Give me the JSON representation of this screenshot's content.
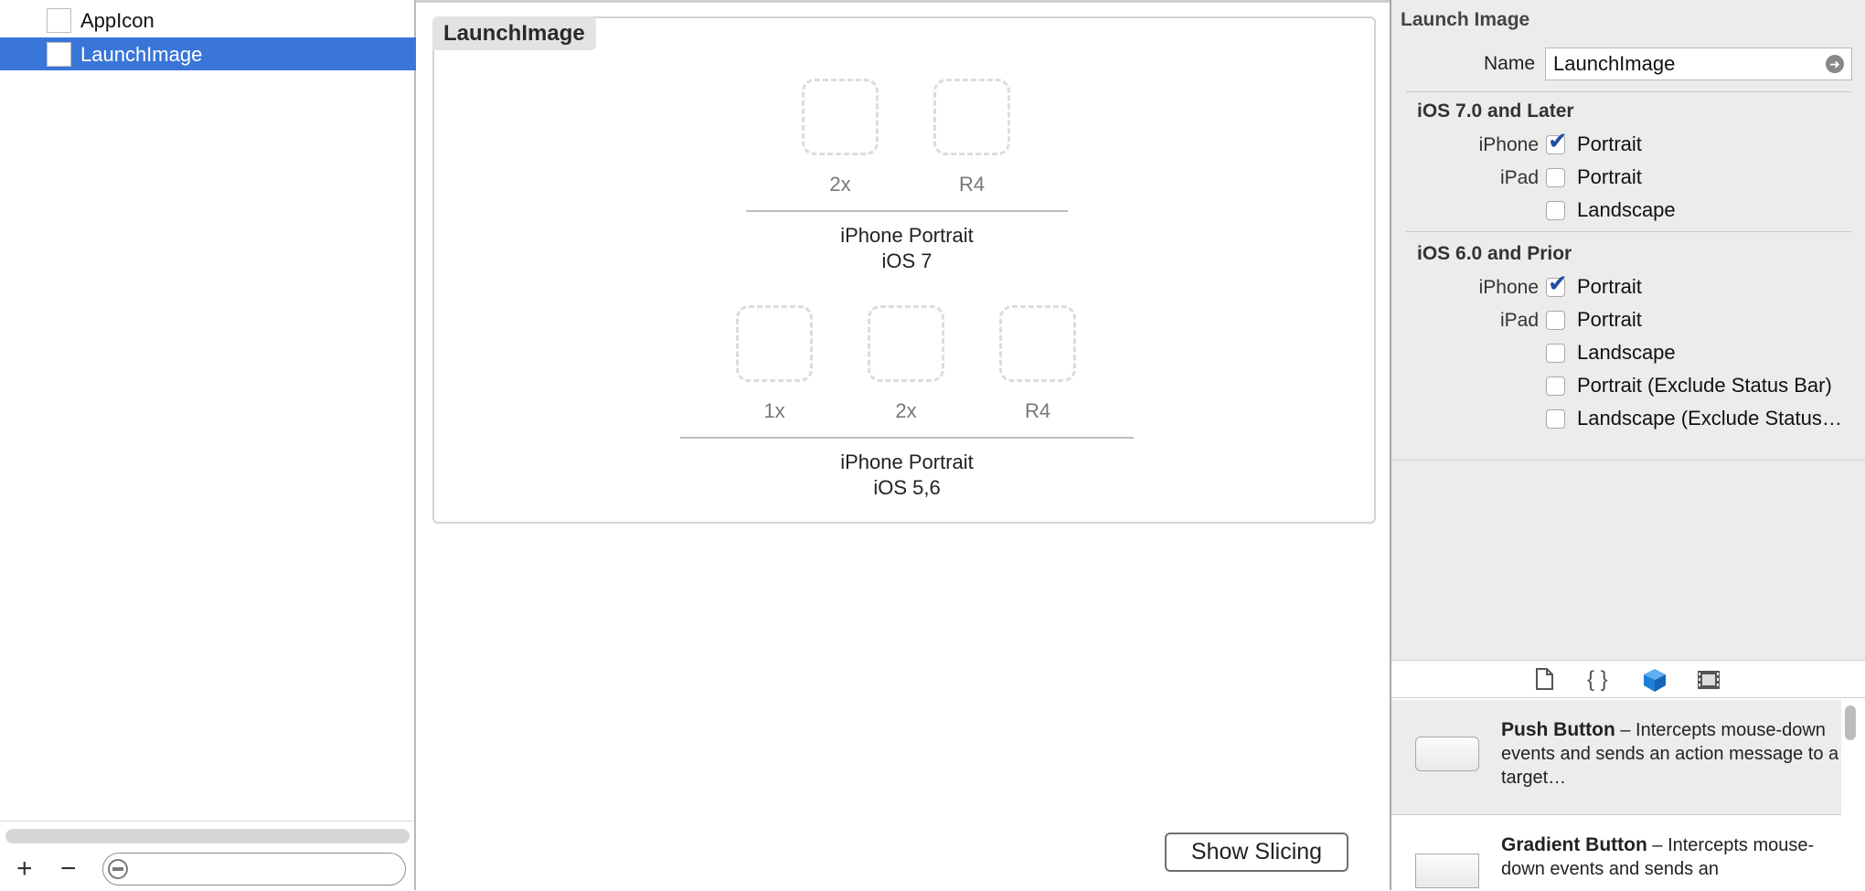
{
  "navigator": {
    "assets": [
      {
        "label": "AppIcon",
        "selected": false
      },
      {
        "label": "LaunchImage",
        "selected": true
      }
    ],
    "add_symbol": "+",
    "remove_symbol": "−"
  },
  "editor": {
    "set_title": "LaunchImage",
    "groups": [
      {
        "slots": [
          "2x",
          "R4"
        ],
        "caption_line1": "iPhone Portrait",
        "caption_line2": "iOS 7"
      },
      {
        "slots": [
          "1x",
          "2x",
          "R4"
        ],
        "caption_line1": "iPhone Portrait",
        "caption_line2": "iOS 5,6"
      }
    ],
    "show_slicing_label": "Show Slicing"
  },
  "inspector": {
    "title": "Launch Image",
    "name_label": "Name",
    "name_value": "LaunchImage",
    "sections": [
      {
        "title": "iOS 7.0 and Later",
        "rows": [
          {
            "device": "iPhone",
            "option": "Portrait",
            "checked": true
          },
          {
            "device": "iPad",
            "option": "Portrait",
            "checked": false
          },
          {
            "device": "",
            "option": "Landscape",
            "checked": false
          }
        ]
      },
      {
        "title": "iOS 6.0 and Prior",
        "rows": [
          {
            "device": "iPhone",
            "option": "Portrait",
            "checked": true
          },
          {
            "device": "iPad",
            "option": "Portrait",
            "checked": false
          },
          {
            "device": "",
            "option": "Landscape",
            "checked": false
          },
          {
            "device": "",
            "option": "Portrait (Exclude Status Bar)",
            "checked": false
          },
          {
            "device": "",
            "option": "Landscape (Exclude Status…",
            "checked": false
          }
        ]
      }
    ]
  },
  "library": {
    "tab_icons": [
      "file-template-icon",
      "code-snippet-icon",
      "object-library-icon",
      "media-library-icon"
    ],
    "items": [
      {
        "name": "Push Button",
        "description": " – Intercepts mouse-down events and sends an action message to a target…",
        "selected": true
      },
      {
        "name": "Gradient Button",
        "description": " – Intercepts mouse-down events and sends an",
        "selected": false
      }
    ]
  },
  "colors": {
    "selection": "#3a75d8",
    "checkmark": "#1f4fa7",
    "object_library_active": "#1e7fd6"
  }
}
